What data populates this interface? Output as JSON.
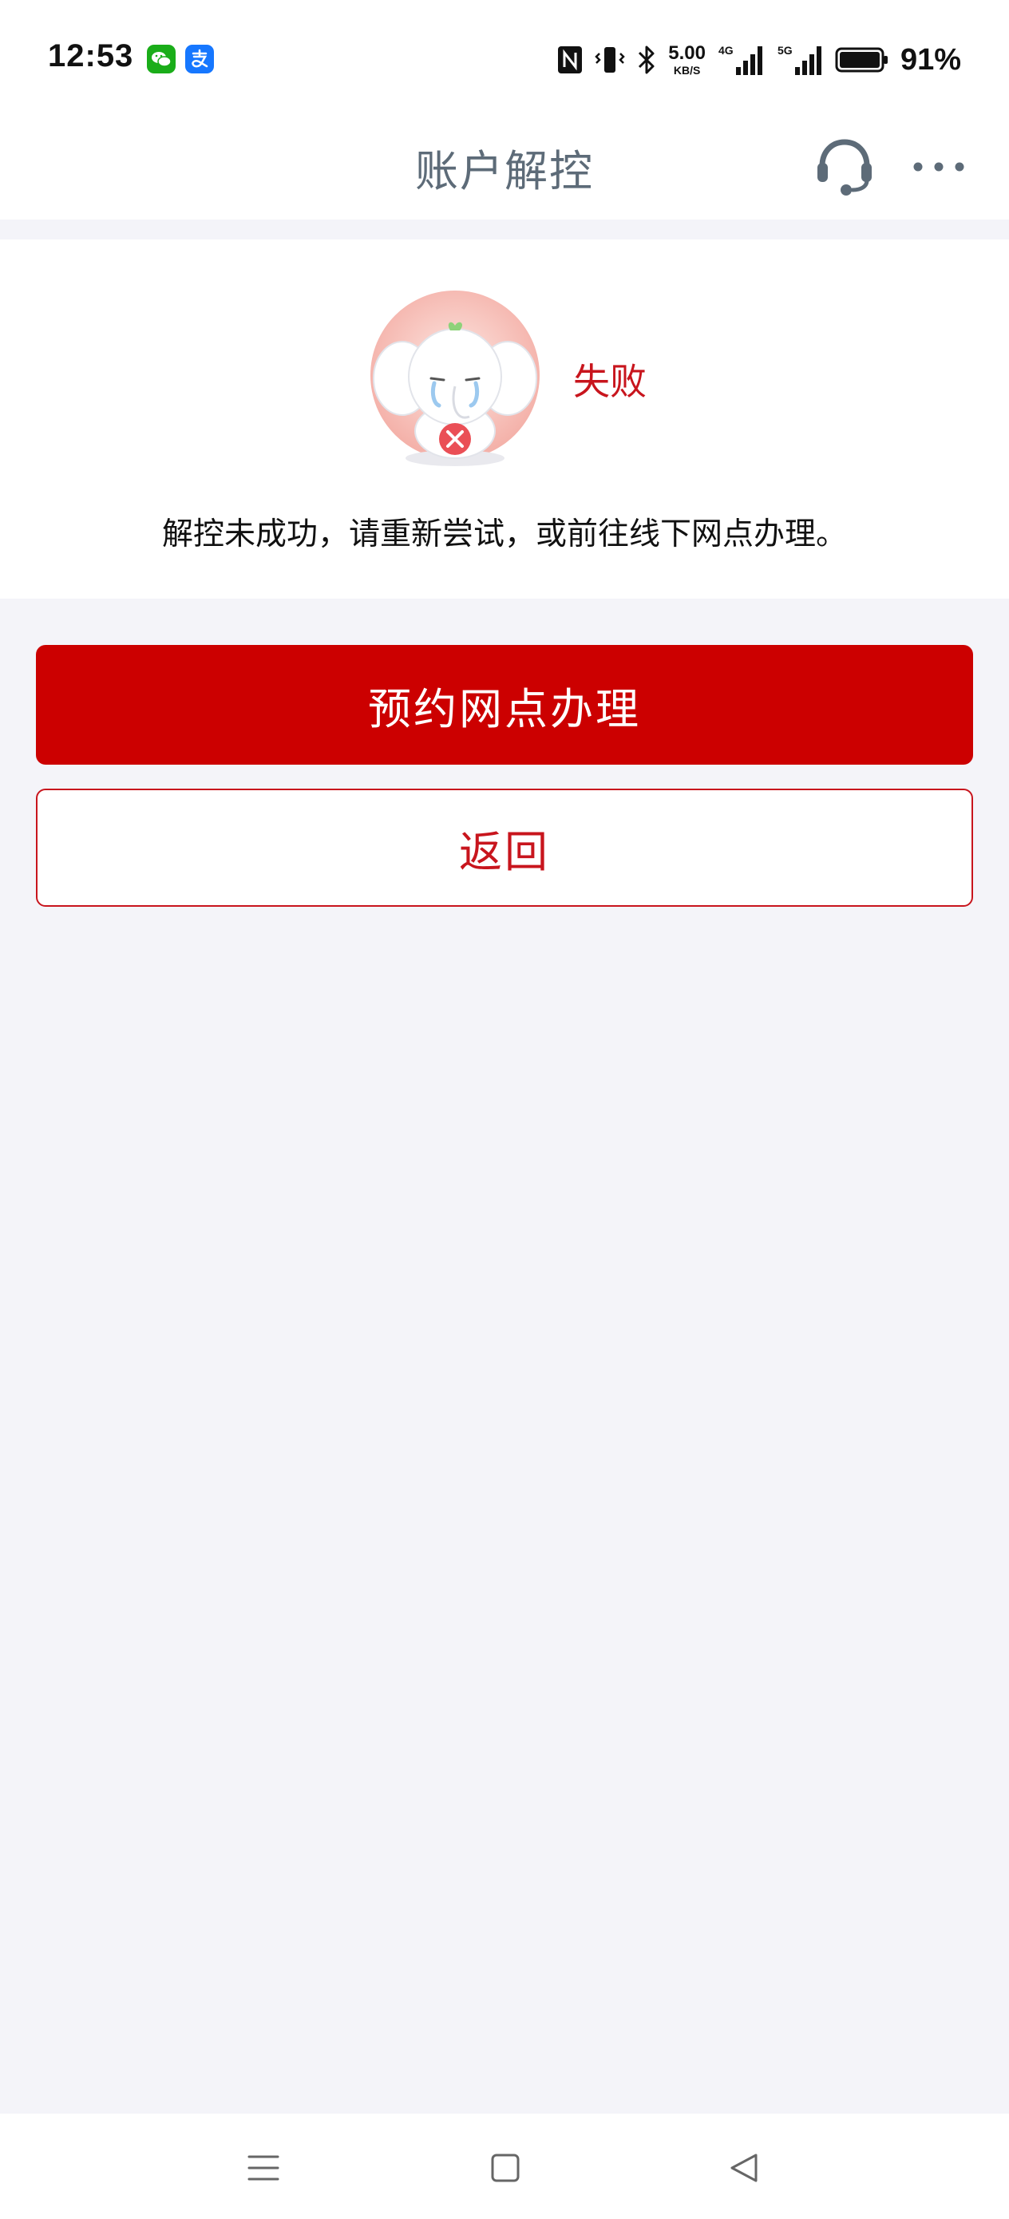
{
  "status_bar": {
    "time": "12:53",
    "apps": [
      "wechat-icon",
      "alipay-icon"
    ],
    "net_speed_value": "5.00",
    "net_speed_unit": "KB/S",
    "signal_1_label": "4G",
    "signal_2_label": "5G",
    "battery_percent": "91%"
  },
  "header": {
    "title": "账户解控",
    "icons": [
      "headset-icon",
      "more-icon"
    ]
  },
  "result": {
    "status": "失败",
    "message": "解控未成功，请重新尝试，或前往线下网点办理。",
    "mascot": "crying-elephant-mascot"
  },
  "actions": {
    "primary_label": "预约网点办理",
    "secondary_label": "返回"
  },
  "colors": {
    "accent": "#cc0000",
    "accent_text": "#c8151d",
    "title_text": "#5d6b78",
    "page_background": "#f4f4f9"
  },
  "system_nav": {
    "icons": [
      "menu-icon",
      "home-icon",
      "back-icon"
    ]
  }
}
